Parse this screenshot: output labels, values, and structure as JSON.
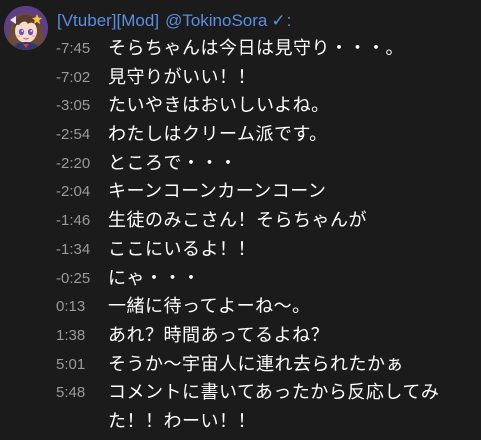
{
  "header": {
    "badges": "[Vtuber][Mod]",
    "username": "@TokinoSora",
    "verified_glyph": "✓",
    "colon": ":"
  },
  "messages": [
    {
      "time": "-7:45",
      "text": "そらちゃんは今日は見守り・・・。"
    },
    {
      "time": "-7:02",
      "text": "見守りがいい！！"
    },
    {
      "time": "-3:05",
      "text": "たいやきはおいしいよね。"
    },
    {
      "time": "-2:54",
      "text": "わたしはクリーム派です。"
    },
    {
      "time": "-2:20",
      "text": "ところで・・・"
    },
    {
      "time": "-2:04",
      "text": "キーンコーンカーンコーン"
    },
    {
      "time": "-1:46",
      "text": "生徒のみこさん！そらちゃんが"
    },
    {
      "time": "-1:34",
      "text": "ここにいるよ！！"
    },
    {
      "time": "-0:25",
      "text": "にゃ・・・"
    },
    {
      "time": "0:13",
      "text": "一緒に待ってよーね〜。"
    },
    {
      "time": "1:38",
      "text": "あれ？時間あってるよね？"
    },
    {
      "time": "5:01",
      "text": "そうか〜宇宙人に連れ去られたかぁ"
    },
    {
      "time": "5:48",
      "text": "コメントに書いてあったから反応してみた！！わーい！！"
    }
  ],
  "colors": {
    "background": "#1b1b1b",
    "username": "#5a8ee0",
    "timestamp": "#9a9a9a",
    "text": "#ffffff"
  }
}
